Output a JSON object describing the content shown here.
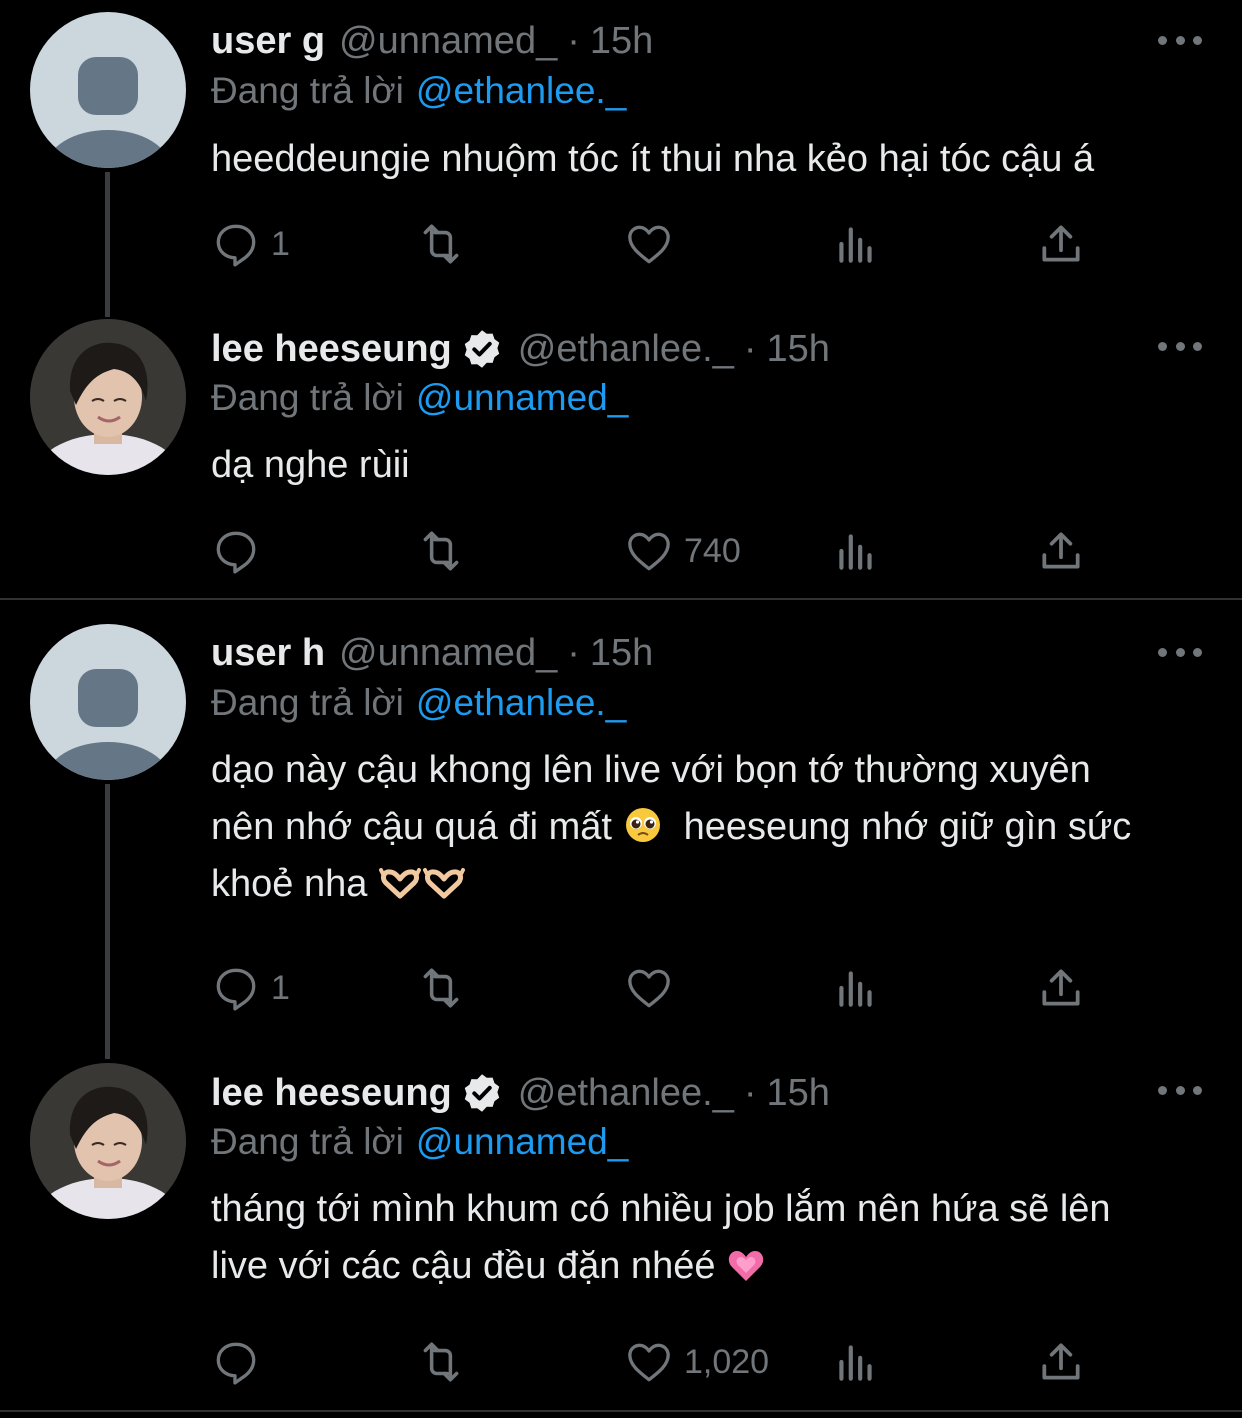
{
  "tweets": [
    {
      "name": "user g",
      "handle": "@unnamed_",
      "dot": "·",
      "time": "15h",
      "verified": false,
      "reply_prefix": "Đang trả lời",
      "reply_mention": "@ethanlee._",
      "text_lines": [
        "heeddeungie nhuộm tóc ít thui nha kẻo hại tóc cậu á"
      ],
      "reply_count": "1",
      "like_count": ""
    },
    {
      "name": "lee heeseung",
      "handle": "@ethanlee._",
      "dot": "·",
      "time": "15h",
      "verified": true,
      "reply_prefix": "Đang trả lời",
      "reply_mention": "@unnamed_",
      "text_lines": [
        "dạ nghe rùii"
      ],
      "reply_count": "",
      "like_count": "740"
    },
    {
      "name": "user h",
      "handle": "@unnamed_",
      "dot": "·",
      "time": "15h",
      "verified": false,
      "reply_prefix": "Đang trả lời",
      "reply_mention": "@ethanlee._",
      "text_lines": [
        "dạo này cậu khong lên live với bọn tớ thường xuyên",
        "nên nhớ cậu quá đi mất",
        "heeseung nhớ giữ gìn sức",
        "khoẻ nha"
      ],
      "reply_count": "1",
      "like_count": ""
    },
    {
      "name": "lee heeseung",
      "handle": "@ethanlee._",
      "dot": "·",
      "time": "15h",
      "verified": true,
      "reply_prefix": "Đang trả lời",
      "reply_mention": "@unnamed_",
      "text_lines": [
        "tháng tới mình khum có nhiều job lắm nên hứa sẽ lên",
        "live với các cậu đều đặn nhéé"
      ],
      "reply_count": "",
      "like_count": "1,020"
    }
  ],
  "colors": {
    "background": "#000000",
    "text": "#e7e9ea",
    "muted": "#71767b",
    "mention": "#1d9bf0",
    "separator": "#2f3336"
  }
}
